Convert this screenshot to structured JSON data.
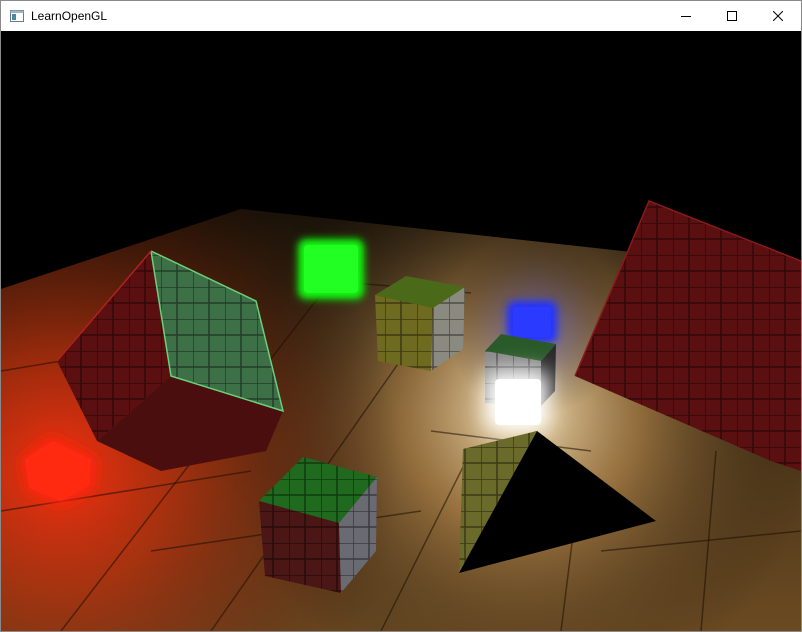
{
  "window": {
    "title": "LearnOpenGL",
    "app_icon": "window-app-icon",
    "controls": {
      "minimize_icon": "minimize-icon",
      "maximize_icon": "maximize-icon",
      "close_icon": "close-icon"
    }
  },
  "scene": {
    "background_color": "#000000",
    "floor_color": "#b48a52",
    "light_colors": {
      "red": "#ff2a10",
      "green": "#10ff10",
      "blue": "#1a2aff",
      "white": "#ffffff"
    },
    "crate_tints": {
      "red": "#6a1010",
      "green": "#2a6a2a",
      "yellow": "#7a7a20",
      "gray": "#8a8a8a"
    }
  }
}
